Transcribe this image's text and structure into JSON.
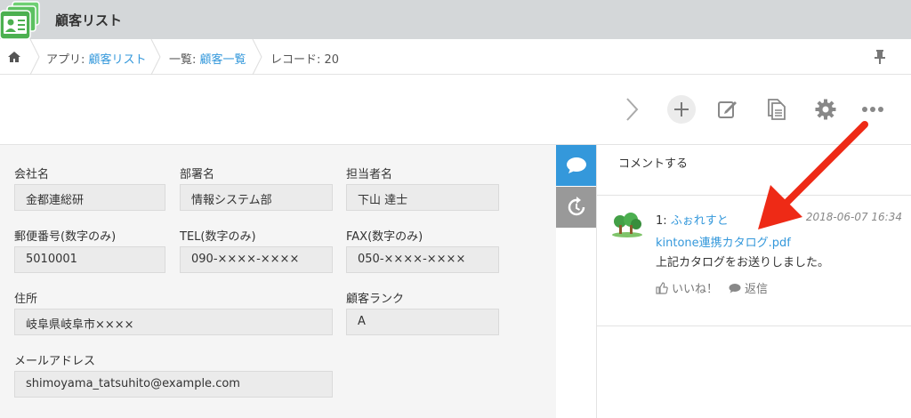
{
  "app": {
    "title": "顧客リスト"
  },
  "breadcrumb": {
    "app_prefix": "アプリ: ",
    "app_name": "顧客リスト",
    "view_prefix": "一覧: ",
    "view_name": "顧客一覧",
    "record": "レコード: 20"
  },
  "icons": {
    "app": "customer-list-app-icon",
    "home": "home-icon",
    "pin": "pin-icon",
    "next": "chevron-right-icon",
    "add": "plus-icon",
    "edit": "edit-icon",
    "duplicate": "duplicate-icon",
    "settings": "gear-icon",
    "more": "more-icon",
    "comments_tab": "comment-bubble-icon",
    "history_tab": "history-icon"
  },
  "fields": {
    "company": {
      "label": "会社名",
      "value": "金都連総研"
    },
    "department": {
      "label": "部署名",
      "value": "情報システム部"
    },
    "person": {
      "label": "担当者名",
      "value": "下山 達士"
    },
    "zip": {
      "label": "郵便番号(数字のみ)",
      "value": "5010001"
    },
    "tel": {
      "label": "TEL(数字のみ)",
      "value": "090-××××-××××"
    },
    "fax": {
      "label": "FAX(数字のみ)",
      "value": "050-××××-××××"
    },
    "address": {
      "label": "住所",
      "value": "岐阜県岐阜市××××"
    },
    "rank": {
      "label": "顧客ランク",
      "value": "A"
    },
    "email": {
      "label": "メールアドレス",
      "value": "shimoyama_tatsuhito@example.com"
    }
  },
  "comments": {
    "prompt": "コメントする",
    "items": [
      {
        "number": "1: ",
        "author": "ふぉれすと",
        "timestamp": "2018-06-07 16:34",
        "attachment": "kintone連携カタログ.pdf",
        "text": "上記カタログをお送りしました。",
        "like_label": "いいね！",
        "reply_label": "返信"
      }
    ]
  },
  "colors": {
    "header_bg": "#d4d7d9",
    "link": "#3498db",
    "active_tab": "#3498db",
    "inactive_tab": "#999999",
    "annotation_arrow": "#ee2a16"
  }
}
